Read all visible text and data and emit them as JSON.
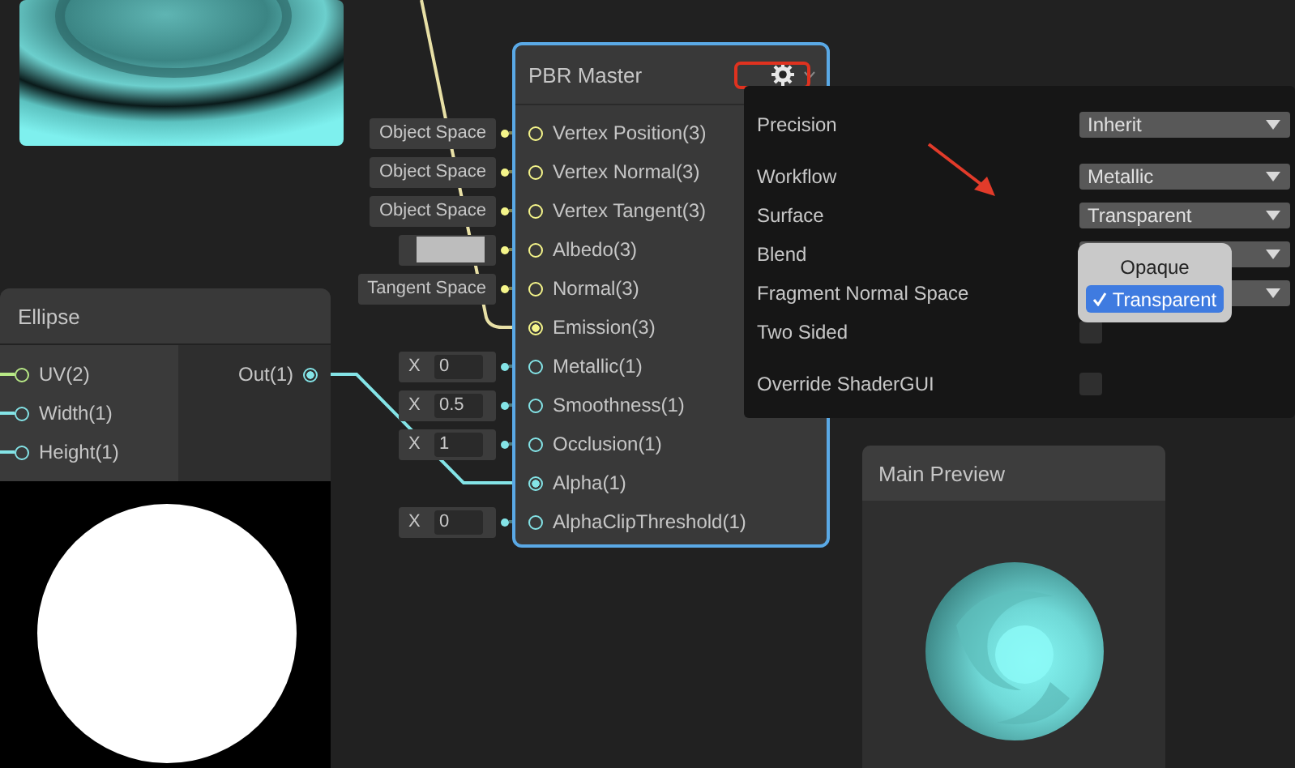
{
  "ellipse_node": {
    "title": "Ellipse",
    "inputs": [
      {
        "label": "UV(2)",
        "color": "#b8e986"
      },
      {
        "label": "Width(1)",
        "color": "#84e4e7"
      },
      {
        "label": "Height(1)",
        "color": "#84e4e7"
      }
    ],
    "outputs": [
      {
        "label": "Out(1)",
        "connected": true
      }
    ]
  },
  "pbr_master_node": {
    "title": "PBR Master",
    "slots": [
      {
        "label": "Vertex Position(3)",
        "color": "#f5f58a",
        "connected": false,
        "input": {
          "kind": "space",
          "value": "Object Space"
        }
      },
      {
        "label": "Vertex Normal(3)",
        "color": "#f5f58a",
        "connected": false,
        "input": {
          "kind": "space",
          "value": "Object Space"
        }
      },
      {
        "label": "Vertex Tangent(3)",
        "color": "#f5f58a",
        "connected": false,
        "input": {
          "kind": "space",
          "value": "Object Space"
        }
      },
      {
        "label": "Albedo(3)",
        "color": "#f5f58a",
        "connected": false,
        "input": {
          "kind": "swatch",
          "color": "#bdbdbd"
        }
      },
      {
        "label": "Normal(3)",
        "color": "#f5f58a",
        "connected": false,
        "input": {
          "kind": "space",
          "value": "Tangent Space"
        }
      },
      {
        "label": "Emission(3)",
        "color": "#f5f58a",
        "connected": true
      },
      {
        "label": "Metallic(1)",
        "color": "#84e4e7",
        "connected": false,
        "input": {
          "kind": "number",
          "axis": "X",
          "value": "0"
        }
      },
      {
        "label": "Smoothness(1)",
        "color": "#84e4e7",
        "connected": false,
        "input": {
          "kind": "number",
          "axis": "X",
          "value": "0.5"
        }
      },
      {
        "label": "Occlusion(1)",
        "color": "#84e4e7",
        "connected": false,
        "input": {
          "kind": "number",
          "axis": "X",
          "value": "1"
        }
      },
      {
        "label": "Alpha(1)",
        "color": "#84e4e7",
        "connected": true
      },
      {
        "label": "AlphaClipThreshold(1)",
        "color": "#84e4e7",
        "connected": false,
        "input": {
          "kind": "number",
          "axis": "X",
          "value": "0"
        }
      }
    ]
  },
  "settings": {
    "rows": [
      {
        "kind": "dropdown",
        "label": "Precision",
        "value": "Inherit"
      },
      {
        "kind": "dropdown",
        "label": "Workflow",
        "value": "Metallic"
      },
      {
        "kind": "dropdown",
        "label": "Surface",
        "value": "Transparent"
      },
      {
        "kind": "dropdown",
        "label": "Blend"
      },
      {
        "kind": "dropdown",
        "label": "Fragment Normal Space"
      },
      {
        "kind": "checkbox",
        "label": "Two Sided",
        "checked": false
      },
      {
        "kind": "checkbox",
        "label": "Override ShaderGUI",
        "checked": false
      }
    ]
  },
  "surface_menu": {
    "options": [
      {
        "label": "Opaque",
        "selected": false
      },
      {
        "label": "Transparent",
        "selected": true
      }
    ]
  },
  "main_preview": {
    "title": "Main Preview"
  }
}
